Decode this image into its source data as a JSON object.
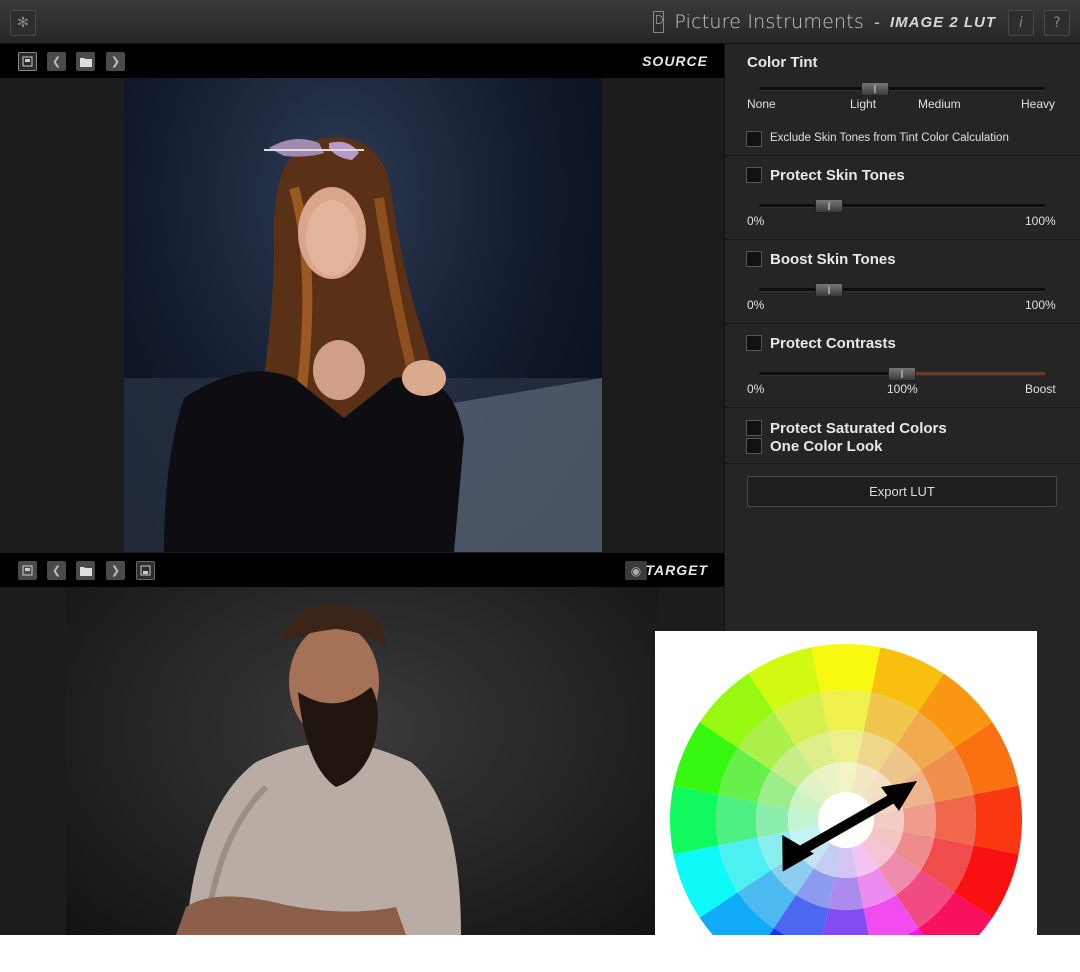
{
  "titlebar": {
    "settings_icon": "gear-icon",
    "brand_name": "Picture Instruments",
    "separator": "-",
    "product_name": "IMAGE 2 LUT",
    "info_label": "i",
    "help_label": "?"
  },
  "source": {
    "label": "SOURCE",
    "tools": [
      "load-image-icon",
      "prev-icon",
      "folder-icon",
      "next-icon"
    ]
  },
  "target": {
    "label": "TARGET",
    "tools": [
      "load-image-icon",
      "prev-icon",
      "folder-icon",
      "next-icon",
      "save-icon"
    ],
    "eye_icon": "eye-icon"
  },
  "panel": {
    "color_tint": {
      "title": "Color Tint",
      "labels": [
        "None",
        "Light",
        "Medium",
        "Heavy"
      ],
      "value": 0.39,
      "exclude_label": "Exclude Skin Tones from Tint Color Calculation"
    },
    "protect_skin": {
      "title": "Protect Skin Tones",
      "min": "0%",
      "max": "100%",
      "value": 0.24
    },
    "boost_skin": {
      "title": "Boost Skin Tones",
      "min": "0%",
      "max": "100%",
      "value": 0.24
    },
    "protect_contrasts": {
      "title": "Protect Contrasts",
      "min": "0%",
      "mid": "100%",
      "max": "Boost",
      "value": 0.5
    },
    "protect_saturated": {
      "title": "Protect Saturated Colors"
    },
    "one_color": {
      "title": "One Color Look"
    },
    "export_label": "Export LUT"
  },
  "colors": {
    "background": "#1b1b1b",
    "panel": "#252525",
    "accent_track": "#6b3a22"
  }
}
